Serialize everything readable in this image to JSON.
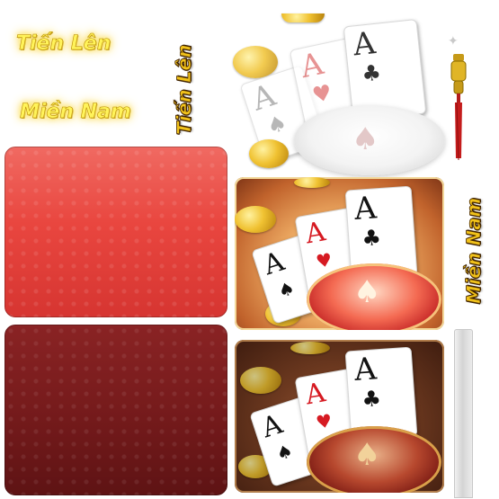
{
  "titles": {
    "tien_len": "Tiến Lên",
    "mien_nam": "Miền Nam",
    "tien_len_vertical": "Tiến Lên",
    "mien_nam_vertical": "Miền Nam"
  },
  "cards": {
    "back": {
      "rank": "A",
      "suit": "♠",
      "suit_color": "black"
    },
    "middle": {
      "rank": "A",
      "suit": "♥",
      "suit_color": "red"
    },
    "front": {
      "rank": "A",
      "suit": "♣",
      "suit_color": "black"
    }
  },
  "colors": {
    "title_yellow": "#fff35a",
    "vertical_gold": "#f1c21a",
    "felt_red": "#ec4a45",
    "felt_dark": "#7b1a1c",
    "tile_glow": "#f3a35c",
    "tile_dark": "#5a2a18"
  },
  "icons": [
    "tassel-icon",
    "sparkle-icon",
    "spade-chip-icon"
  ]
}
